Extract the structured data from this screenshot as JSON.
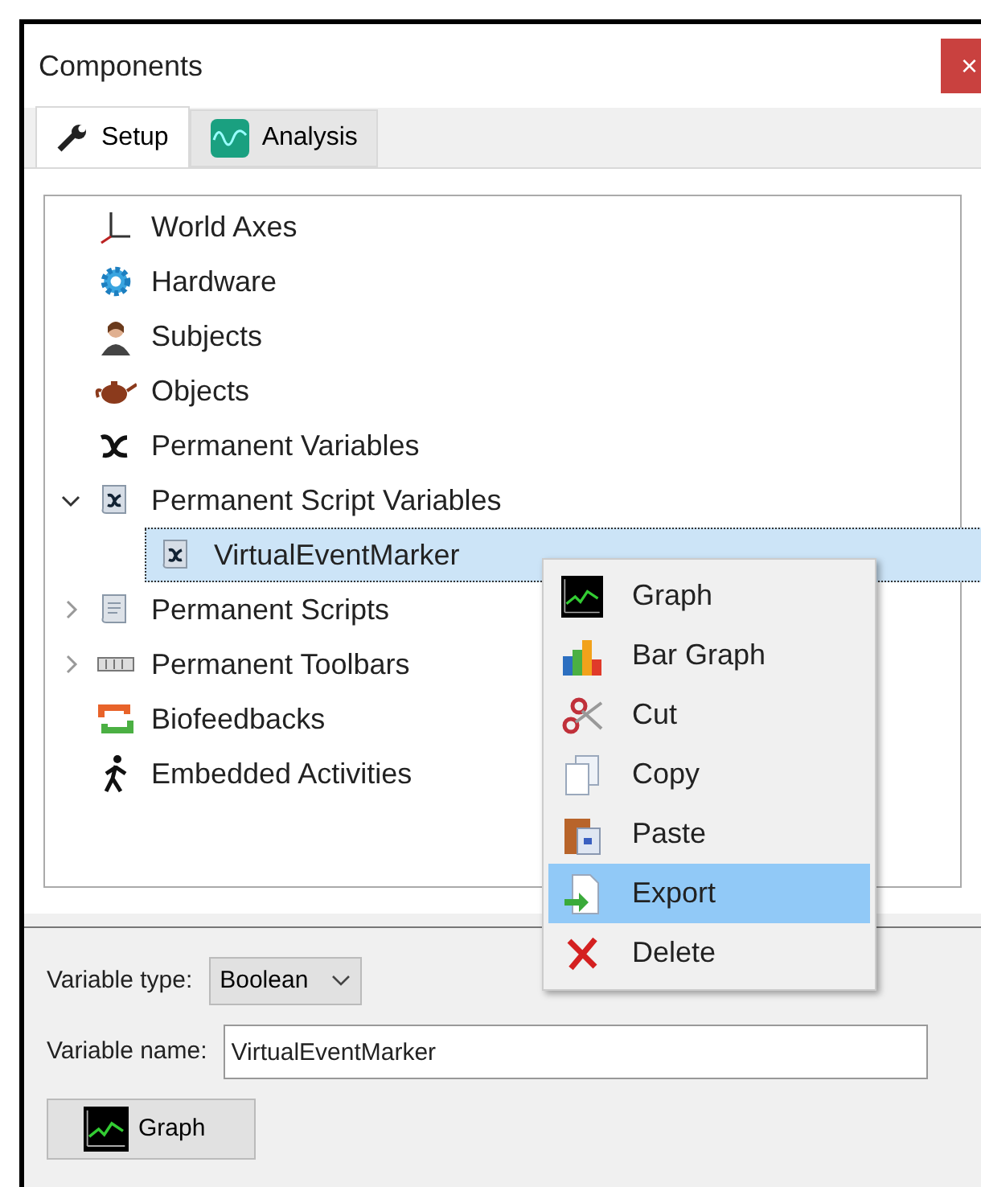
{
  "window": {
    "title": "Components",
    "close": "×"
  },
  "tabs": [
    {
      "label": "Setup",
      "selected": true
    },
    {
      "label": "Analysis",
      "selected": false
    }
  ],
  "tree": {
    "items": [
      {
        "label": "World Axes",
        "selected": false
      },
      {
        "label": "Hardware",
        "selected": false
      },
      {
        "label": "Subjects",
        "selected": false
      },
      {
        "label": "Objects",
        "selected": false
      },
      {
        "label": "Permanent Variables",
        "selected": false
      },
      {
        "label": "Permanent Script Variables",
        "selected": false,
        "expanded": true,
        "children": [
          {
            "label": "VirtualEventMarker",
            "selected": true
          }
        ]
      },
      {
        "label": "Permanent Scripts",
        "selected": false,
        "expanded": false
      },
      {
        "label": "Permanent Toolbars",
        "selected": false,
        "expanded": false
      },
      {
        "label": "Biofeedbacks",
        "selected": false
      },
      {
        "label": "Embedded Activities",
        "selected": false
      }
    ]
  },
  "context_menu": {
    "items": [
      {
        "label": "Graph",
        "selected": false
      },
      {
        "label": "Bar Graph",
        "selected": false
      },
      {
        "label": "Cut",
        "selected": false
      },
      {
        "label": "Copy",
        "selected": false
      },
      {
        "label": "Paste",
        "selected": false
      },
      {
        "label": "Export",
        "selected": true
      },
      {
        "label": "Delete",
        "selected": false
      }
    ]
  },
  "form": {
    "variable_type": {
      "label": "Variable type:",
      "value": "Boolean"
    },
    "variable_name": {
      "label": "Variable name:",
      "value": "VirtualEventMarker"
    },
    "graph_button": {
      "label": "Graph"
    }
  }
}
